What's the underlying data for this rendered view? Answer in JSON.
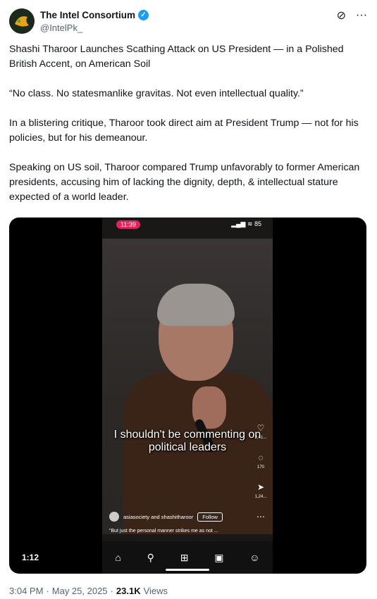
{
  "account": {
    "name": "The Intel Consortium",
    "handle": "@IntelPk_",
    "verified_icon": "verified-badge-icon",
    "brand_color": "#1d9bf0"
  },
  "header_icons": [
    "grok-icon",
    "more-icon"
  ],
  "post": {
    "paragraphs": [
      "Shashi Tharoor Launches Scathing Attack on US President — in a Polished British Accent, on American Soil",
      "“No class. No statesmanlike gravitas. Not even intellectual quality.”",
      "In a blistering critique, Tharoor took direct aim at President Trump — not for his policies, but for his demeanour.",
      "Speaking on US soil, Tharoor compared Trump unfavorably to former American presidents, accusing him of lacking the dignity, depth, & intellectual stature expected of a world leader."
    ]
  },
  "video": {
    "duration": "1:12",
    "phone_clock": "11:39",
    "phone_status": "▂▄▆ ≋ 85",
    "caption": "I shouldn't be commenting on political leaders",
    "account_line": "asiasociety and shashitharoor",
    "follow_label": "Follow",
    "subcaption": "\"But just the personal manner strikes me as not ...",
    "rail_counts": [
      "2,41...",
      "170",
      "1,24..."
    ]
  },
  "meta": {
    "time": "3:04 PM",
    "separator": "·",
    "date": "May 25, 2025",
    "views_count": "23.1K",
    "views_label": "Views"
  }
}
